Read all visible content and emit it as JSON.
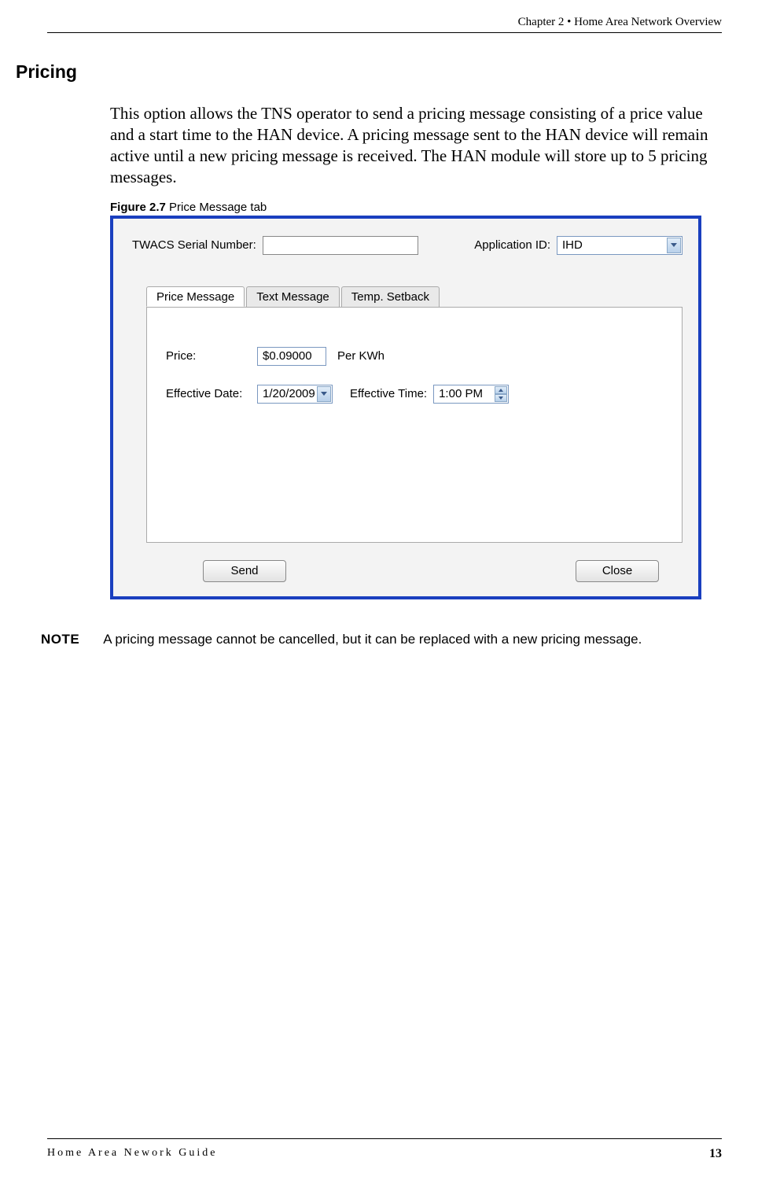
{
  "header": {
    "chapter_line": "Chapter 2 • Home Area Network Overview"
  },
  "section": {
    "title": "Pricing",
    "paragraph": "This option allows the TNS operator to send a pricing message consisting of a price value and a start time to the HAN device. A pricing message sent to the HAN device will remain active until a new pricing message is received. The HAN module will store up to 5 pricing messages."
  },
  "figure": {
    "label": "Figure 2.7",
    "title": "Price Message tab"
  },
  "dialog": {
    "serial_label": "TWACS Serial Number:",
    "serial_value": "",
    "appid_label": "Application ID:",
    "appid_value": "IHD",
    "tabs": {
      "price": "Price Message",
      "text": "Text Message",
      "temp": "Temp. Setback"
    },
    "form": {
      "price_label": "Price:",
      "price_value": "$0.09000",
      "price_unit": "Per KWh",
      "date_label": "Effective Date:",
      "date_value": "1/20/2009",
      "time_label": "Effective Time:",
      "time_value": "1:00 PM"
    },
    "buttons": {
      "send": "Send",
      "close": "Close"
    }
  },
  "note": {
    "label": "NOTE",
    "text": "A pricing message cannot be cancelled, but it can be replaced with a new pricing message."
  },
  "footer": {
    "guide": "Home Area Nework Guide",
    "page": "13"
  }
}
